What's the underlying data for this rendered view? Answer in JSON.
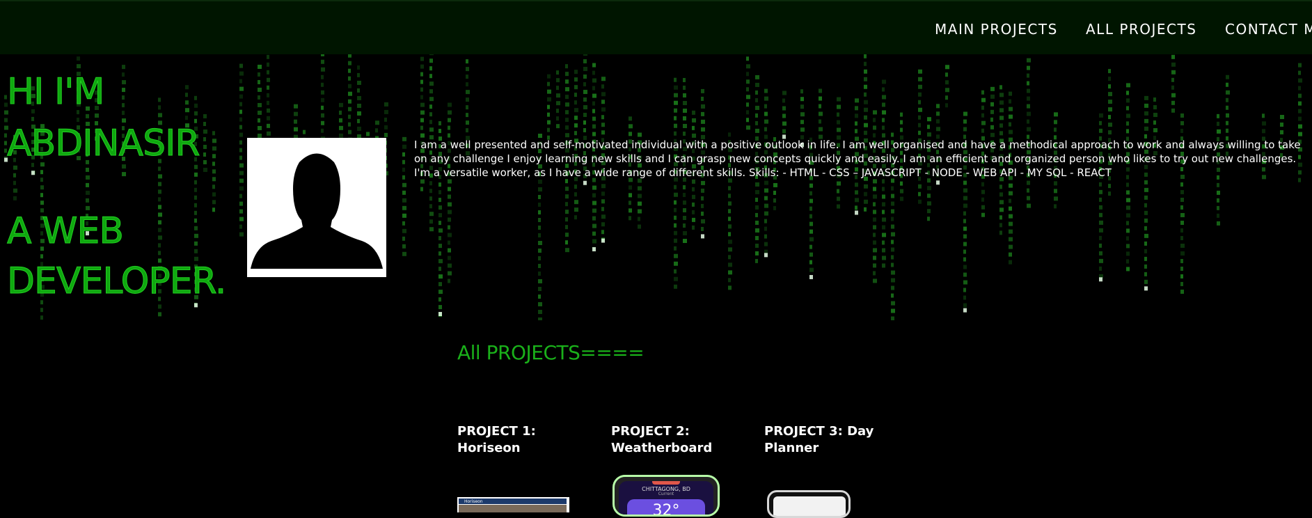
{
  "nav": {
    "items": [
      "MAIN PROJECTS",
      "ALL PROJECTS",
      "CONTACT ME"
    ]
  },
  "hero": {
    "greeting_line1": "HI I'M",
    "greeting_line2": "ABDINASIR",
    "greeting_line3": "A WEB",
    "greeting_line4": "DEVELOPER.",
    "bio": "I am a well presented and self-motivated individual with a positive outlook in life. I am well organised and have a methodical approach to work and always willing to take on any challenge I enjoy learning new skills and I can grasp new concepts quickly and easily. I am an efficient and organized person who likes to try out new challenges. I'm a versatile worker, as I have a wide range of different skills. Skills: - HTML - CSS – JAVASCRIPT - NODE - WEB API - MY SQL - REACT"
  },
  "projects_section": {
    "title": "All PROJECTS====",
    "projects": [
      {
        "title": "PROJECT 1: Horiseon",
        "thumb_label": "Horiseon"
      },
      {
        "title": "PROJECT 2: Weatherboard",
        "thumb_city": "CHITTAGONG, BD",
        "thumb_sub": "Current",
        "thumb_temp": "32°"
      },
      {
        "title": "PROJECT 3: Day Planner"
      }
    ]
  },
  "colors": {
    "accent_green": "#1ab01a",
    "nav_background": "#001500",
    "rain_green": "#1f8f1f"
  }
}
